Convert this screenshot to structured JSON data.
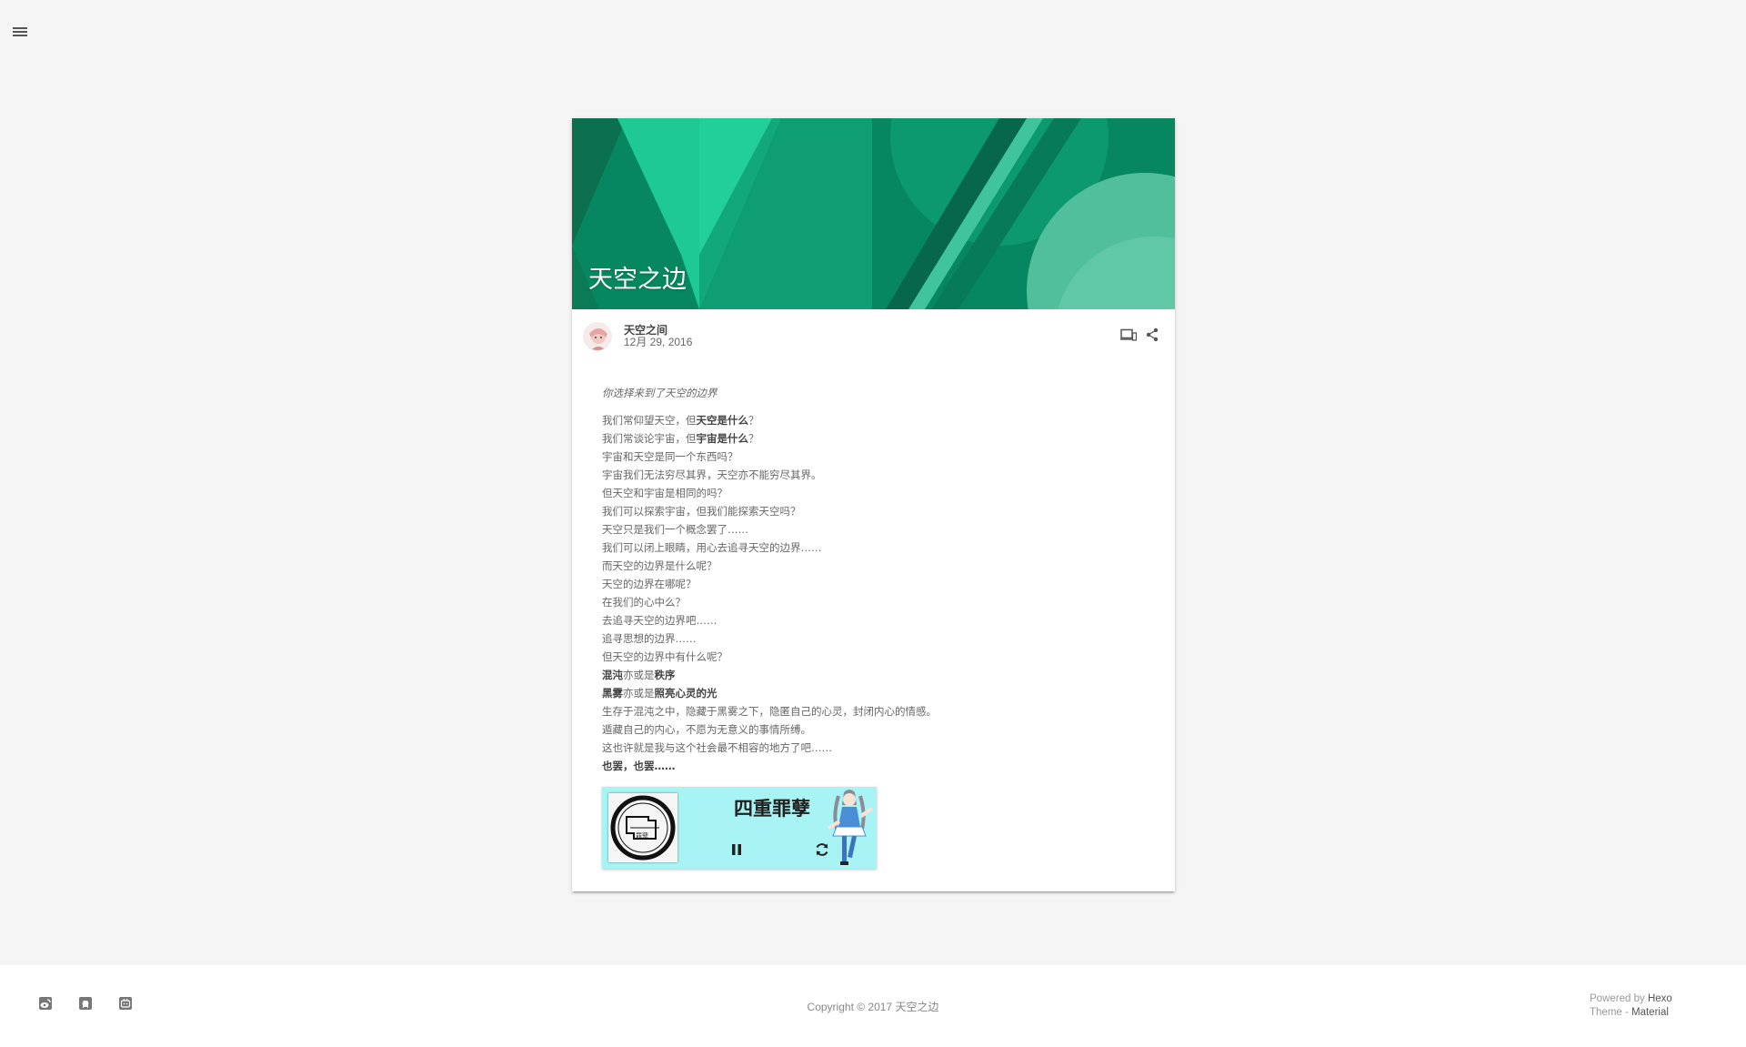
{
  "nav": {
    "menu_icon": "hamburger-menu-icon"
  },
  "post": {
    "banner_title": "天空之边",
    "author": "天空之间",
    "date": "12月 29, 2016",
    "meta_icons": [
      "devices-icon",
      "share-icon"
    ],
    "intro_prefix": "你选择来到了",
    "intro_em": "天空的边界",
    "lines": [
      {
        "text": "我们常仰望天空，但",
        "bold": "天空是什么",
        "tail": "？"
      },
      {
        "text": "我们常谈论宇宙，但",
        "bold": "宇宙是什么",
        "tail": "？"
      },
      {
        "text": "宇宙和天空是同一个东西吗？",
        "bold": "",
        "tail": ""
      },
      {
        "text": "宇宙我们无法穷尽其界，天空亦不能穷尽其界。",
        "bold": "",
        "tail": ""
      },
      {
        "text": "但天空和宇宙是相同的吗？",
        "bold": "",
        "tail": ""
      },
      {
        "text": "我们可以探索宇宙，但我们能探索天空吗？",
        "bold": "",
        "tail": ""
      },
      {
        "text": "天空只是我们一个概念罢了……",
        "bold": "",
        "tail": ""
      },
      {
        "text": "我们可以闭上眼睛，用心去追寻天空的边界……",
        "bold": "",
        "tail": ""
      },
      {
        "text": "而天空的边界是什么呢？",
        "bold": "",
        "tail": ""
      },
      {
        "text": "天空的边界在哪呢？",
        "bold": "",
        "tail": ""
      },
      {
        "text": "在我们的心中么？",
        "bold": "",
        "tail": ""
      },
      {
        "text": "去追寻天空的边界吧……",
        "bold": "",
        "tail": ""
      },
      {
        "text": "追寻思想的边界……",
        "bold": "",
        "tail": ""
      },
      {
        "text": "但天空的边界中有什么呢？",
        "bold": "",
        "tail": ""
      }
    ],
    "line_chaos": {
      "a": "混沌",
      "b": "亦或是",
      "c": "秩序"
    },
    "line_dark": {
      "a": "黑雾",
      "b": "亦或是",
      "c": "照亮心灵的光"
    },
    "lines_after": [
      "生存于混沌之中，隐藏于黑雾之下，隐匿自己的心灵，封闭内心的情感。",
      "遁藏自己的内心，不愿为无意义的事情所缚。",
      "这也许就是我与这个社会最不相容的地方了吧……"
    ],
    "closing": "也罢，也罢……"
  },
  "player": {
    "song_title": "四重罪孽",
    "cover_text": "罪孽",
    "pause_icon": "pause-icon",
    "refresh_icon": "refresh-icon"
  },
  "footer": {
    "social_icons": [
      "weibo-icon",
      "github-icon",
      "bilibili-icon"
    ],
    "copyright": "Copyright ©  2017  天空之边",
    "powered_by_label": "Powered by",
    "powered_by_link": "Hexo",
    "theme_label": "Theme - ",
    "theme_link": "Material"
  },
  "colors": {
    "banner_base": "#0a8a62",
    "banner_light": "#1fc994",
    "player_bg": "#a8f4f4",
    "page_bg": "#f5f5f5"
  }
}
